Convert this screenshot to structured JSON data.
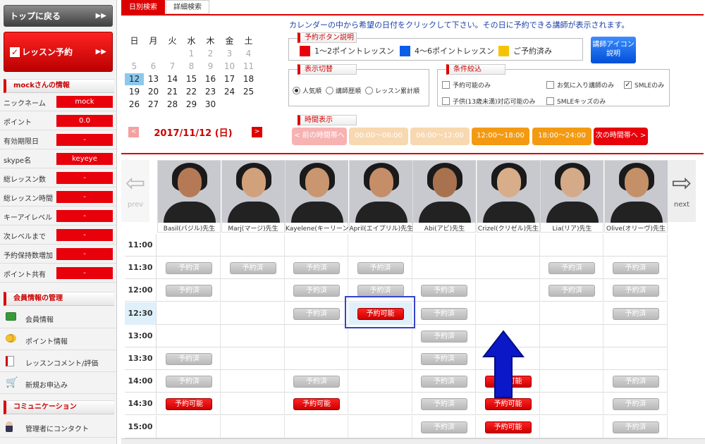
{
  "sidebar": {
    "top_button": "トップに戻る",
    "lesson_button": "レッスン予約",
    "user_section": "mockさんの情報",
    "info": [
      {
        "label": "ニックネーム",
        "value": "mock"
      },
      {
        "label": "ポイント",
        "value": "0.0"
      },
      {
        "label": "有効期限日",
        "value": "-"
      },
      {
        "label": "skype名",
        "value": "keyeye"
      },
      {
        "label": "総レッスン数",
        "value": "-"
      },
      {
        "label": "総レッスン時間",
        "value": "-"
      },
      {
        "label": "キーアイレベル",
        "value": "-"
      },
      {
        "label": "次レベルまで",
        "value": "-"
      },
      {
        "label": "予約保持数増加",
        "value": "-"
      },
      {
        "label": "ポイント共有",
        "value": "-"
      }
    ],
    "member_section": "会員情報の管理",
    "member_links": [
      {
        "label": "会員情報",
        "icon": "member-card-icon"
      },
      {
        "label": "ポイント情報",
        "icon": "coins-icon"
      },
      {
        "label": "レッスンコメント/評価",
        "icon": "notepad-icon"
      },
      {
        "label": "新規お申込み",
        "icon": "cart-icon"
      }
    ],
    "comm_section": "コミュニケーション",
    "comm_links": [
      {
        "label": "管理者にコンタクト",
        "icon": "person-icon"
      }
    ]
  },
  "tabs": [
    "日別検索",
    "詳細検索"
  ],
  "instruction": "カレンダーの中から希望の日付をクリックして下さい。その日に予約できる講師が表示されます。",
  "calendar": {
    "weekdays": [
      "日",
      "月",
      "火",
      "水",
      "木",
      "金",
      "土"
    ],
    "selected_date": "2017/11/12 (日)",
    "prev": "<",
    "next": ">"
  },
  "legend": {
    "title": "予約ボタン説明",
    "items": [
      {
        "label": "1〜2ポイントレッスン",
        "color": "#e8000b"
      },
      {
        "label": "4〜6ポイントレッスン",
        "color": "#0a5ee8"
      },
      {
        "label": "ご予約済み",
        "color": "#f5c400"
      }
    ]
  },
  "icon_button": "講師アイコン説明",
  "display_switch": {
    "title": "表示切替",
    "options": [
      "人気順",
      "講師歴順",
      "レッスン累計順"
    ],
    "selected": "人気順"
  },
  "filters": {
    "title": "条件絞込",
    "items": [
      {
        "label": "予約可能のみ",
        "checked": false
      },
      {
        "label": "お気に入り講師のみ",
        "checked": false
      },
      {
        "label": "SMLEのみ",
        "checked": true
      },
      {
        "label": "子供(13歳未満)対応可能のみ",
        "checked": false
      },
      {
        "label": "SMLEキッズのみ",
        "checked": false
      }
    ]
  },
  "time_display": {
    "title": "時間表示",
    "buttons": [
      {
        "label": "< 前の時間帯へ",
        "style": "#f7b2b2"
      },
      {
        "label": "00:00〜06:00",
        "style": "#f7d8b0"
      },
      {
        "label": "06:00〜12:00",
        "style": "#f7d8b0"
      },
      {
        "label": "12:00〜18:00",
        "style": "#f39a12"
      },
      {
        "label": "18:00〜24:00",
        "style": "#f39a12"
      },
      {
        "label": "次の時間帯へ >",
        "style": "#e8000b"
      }
    ]
  },
  "nav": {
    "prev": "prev",
    "next": "next"
  },
  "teachers": [
    "Basil(バジル)先生",
    "Marj(マージ)先生",
    "Kayelene(キーリーン)先生",
    "April(エイプリル)先生",
    "Abi(アビ)先生",
    "Crizel(クリゼル)先生",
    "Lia(リア)先生",
    "Olive(オリーヴ)先生"
  ],
  "slot_labels": {
    "booked": "予約済",
    "available": "予約可能"
  },
  "schedule": [
    {
      "time": "11:00",
      "slots": [
        "",
        "",
        "",
        "",
        "",
        "",
        "",
        ""
      ]
    },
    {
      "time": "11:30",
      "slots": [
        "booked",
        "booked",
        "booked",
        "booked",
        "",
        "",
        "booked",
        "booked"
      ]
    },
    {
      "time": "12:00",
      "slots": [
        "booked",
        "",
        "booked",
        "booked",
        "booked",
        "",
        "booked",
        "booked"
      ]
    },
    {
      "time": "12:30",
      "slots": [
        "",
        "",
        "booked",
        "available",
        "booked",
        "",
        "",
        "booked"
      ]
    },
    {
      "time": "13:00",
      "slots": [
        "",
        "",
        "",
        "",
        "booked",
        "",
        "",
        ""
      ]
    },
    {
      "time": "13:30",
      "slots": [
        "booked",
        "",
        "",
        "",
        "booked",
        "",
        "",
        ""
      ]
    },
    {
      "time": "14:00",
      "slots": [
        "booked",
        "",
        "booked",
        "",
        "booked",
        "available",
        "",
        "booked"
      ]
    },
    {
      "time": "14:30",
      "slots": [
        "available",
        "",
        "available",
        "",
        "booked",
        "available",
        "",
        "booked"
      ]
    },
    {
      "time": "15:00",
      "slots": [
        "",
        "",
        "",
        "",
        "booked",
        "available",
        "",
        "booked"
      ]
    }
  ]
}
